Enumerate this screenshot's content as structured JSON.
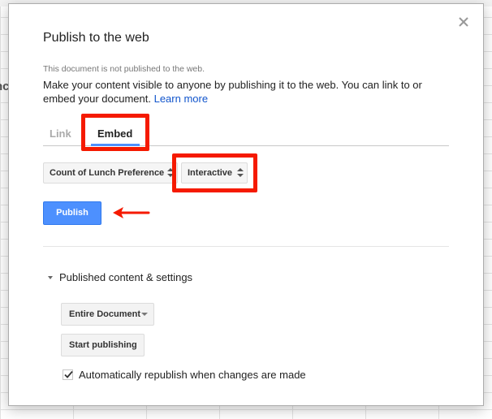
{
  "background": {
    "text_fragment": "nc"
  },
  "dialog": {
    "title": "Publish to the web",
    "close_symbol": "×",
    "note": "This document is not published to the web.",
    "description": "Make your content visible to anyone by publishing it to the web. You can link to or embed your document.",
    "learn_more": "Learn more"
  },
  "tabs": [
    {
      "label": "Link",
      "active": false
    },
    {
      "label": "Embed",
      "active": true
    }
  ],
  "selects": {
    "chart": "Count of Lunch Preference",
    "mode": "Interactive"
  },
  "publish_button": "Publish",
  "published_settings": {
    "header": "Published content & settings",
    "scope_select": "Entire Document",
    "start_button": "Start publishing",
    "auto_republish_label": "Automatically republish when changes are made",
    "auto_republish_checked": true
  },
  "icons": {
    "close": "close-icon",
    "updown": "updown-arrows-icon",
    "dropdown": "chevron-down-icon",
    "triangle": "triangle-down-icon",
    "check": "check-icon",
    "annotation": "red-arrow-annotation"
  },
  "colors": {
    "primary_blue": "#4d90fe",
    "link_blue": "#1155cc",
    "annotation_red": "#f51a00"
  }
}
